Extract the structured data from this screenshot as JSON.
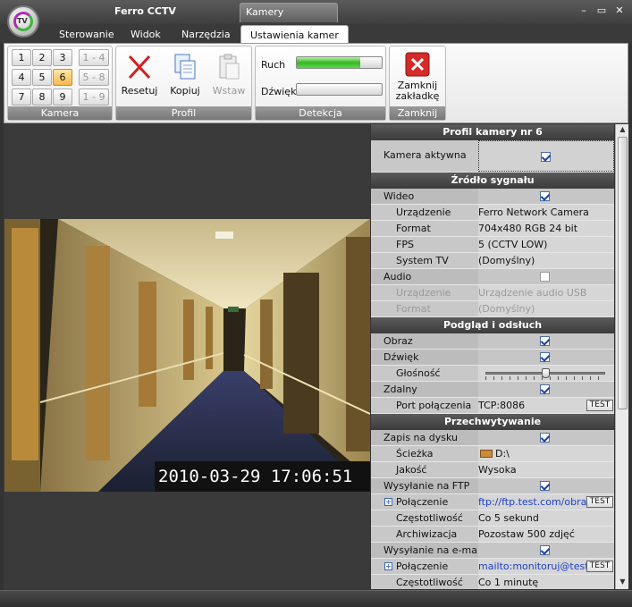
{
  "app": {
    "title": "Ferro CCTV",
    "context_group": "Kamery",
    "logo_text": "TV"
  },
  "window_controls": [
    "–",
    "▭",
    "✕"
  ],
  "tabs": [
    "Sterowanie",
    "Widok",
    "Narzędzia",
    "Ustawienia kamer"
  ],
  "ribbon": {
    "kamera": {
      "label": "Kamera",
      "numbers": [
        "1",
        "2",
        "3",
        "4",
        "5",
        "6",
        "7",
        "8",
        "9"
      ],
      "selected": "6",
      "ranges": [
        "1 - 4",
        "5 - 8",
        "1 - 9"
      ]
    },
    "profil": {
      "label": "Profil",
      "reset": "Resetuj",
      "copy": "Kopiuj",
      "paste": "Wstaw"
    },
    "detekcja": {
      "label": "Detekcja",
      "motion": "Ruch",
      "motion_level": 0.75,
      "sound": "Dźwięk",
      "sound_level": 0.0
    },
    "zamknij": {
      "label": "Zamknij",
      "close_line1": "Zamknij",
      "close_line2": "zakładkę"
    }
  },
  "video": {
    "timestamp": "2010-03-29 17:06:51"
  },
  "props": {
    "header": "Profil kamery nr 6",
    "active_label": "Kamera aktywna",
    "source": {
      "title": "Źródło sygnału",
      "video": "Wideo",
      "device": "Urządzenie",
      "device_val": "Ferro Network Camera",
      "format": "Format",
      "format_val": "704x480 RGB 24 bit",
      "fps": "FPS",
      "fps_val": "5 (CCTV LOW)",
      "tv": "System TV",
      "tv_val": "(Domyślny)",
      "audio": "Audio",
      "a_device": "Urządzenie",
      "a_device_val": "Urządzenie audio USB",
      "a_format": "Format",
      "a_format_val": "(Domyślny)"
    },
    "preview": {
      "title": "Podgląd i odsłuch",
      "image": "Obraz",
      "sound": "Dźwięk",
      "volume": "Głośność",
      "volume_level": 0.5,
      "remote": "Zdalny",
      "port": "Port połączenia",
      "port_val": "TCP:8086",
      "test": "TEST"
    },
    "capture": {
      "title": "Przechwytywanie",
      "disk": "Zapis na dysku",
      "path": "Ścieżka",
      "path_val": "D:\\",
      "quality": "Jakość",
      "quality_val": "Wysoka",
      "ftp": "Wysyłanie na FTP",
      "ftp_conn": "Połączenie",
      "ftp_conn_val": "ftp://ftp.test.com/obra...",
      "test": "TEST",
      "ftp_freq": "Częstotliwość",
      "ftp_freq_val": "Co 5 sekund",
      "ftp_arch": "Archiwizacja",
      "ftp_arch_val": "Pozostaw 500 zdjęć",
      "email": "Wysyłanie na e-mail",
      "mail_conn": "Połączenie",
      "mail_conn_val": "mailto:monitoruj@test....",
      "mail_freq": "Częstotliwość",
      "mail_freq_val": "Co 1 minutę"
    }
  }
}
